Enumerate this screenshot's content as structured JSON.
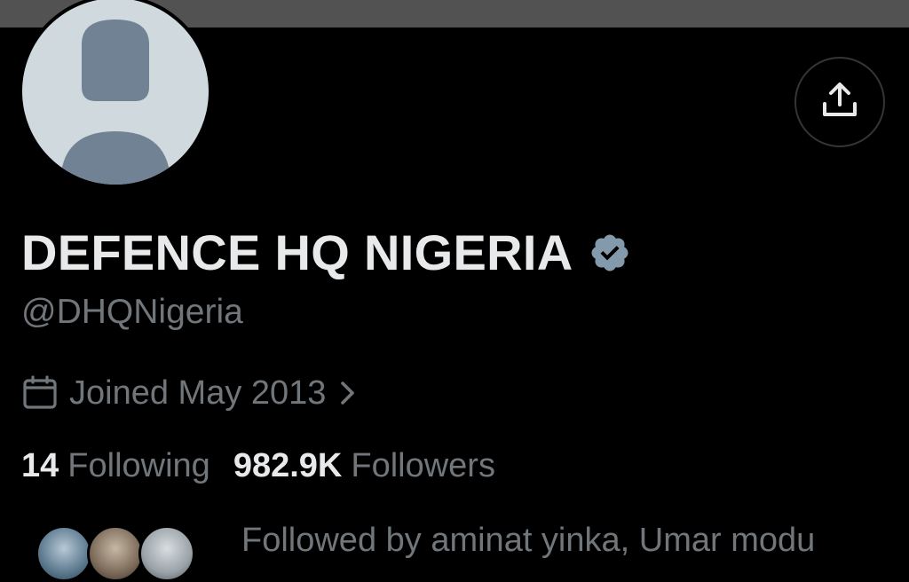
{
  "profile": {
    "display_name": "DEFENCE HQ NIGERIA",
    "handle": "@DHQNigeria",
    "verified_badge_color": "#829aab",
    "joined": "Joined May 2013",
    "following_count": "14",
    "following_label": "Following",
    "followers_count": "982.9K",
    "followers_label": "Followers",
    "followed_by": "Followed by aminat yinka, Umar modu"
  },
  "icons": {
    "share": "share-upload-icon",
    "calendar": "calendar-icon",
    "chevron": "chevron-right-icon",
    "verified": "verified-badge-icon"
  },
  "colors": {
    "background": "#000000",
    "banner": "#525252",
    "primary_text": "#e7e9ea",
    "secondary_text": "#71767b",
    "avatar_bg": "#cfd9de",
    "avatar_figure": "#708294"
  }
}
